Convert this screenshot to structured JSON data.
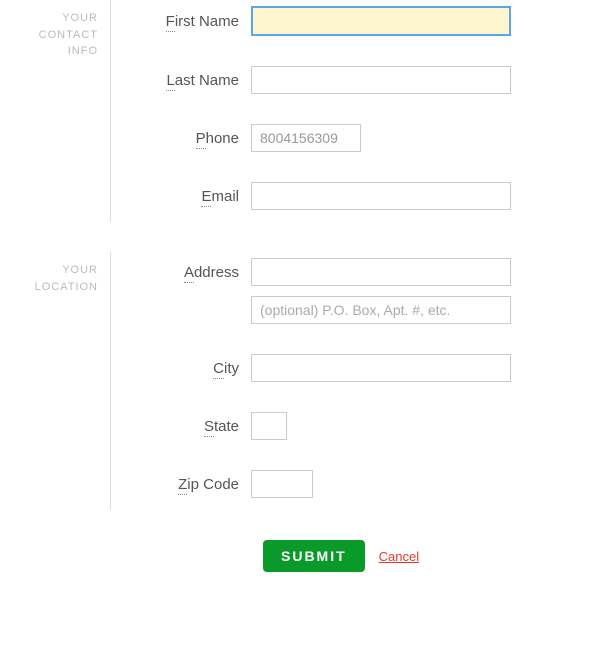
{
  "sections": {
    "contact": {
      "title_line1": "YOUR",
      "title_line2": "CONTACT",
      "title_line3": "INFO",
      "first_name": {
        "label_first": "F",
        "label_rest": "irst Name",
        "value": ""
      },
      "last_name": {
        "label_first": "L",
        "label_rest": "ast Name",
        "value": ""
      },
      "phone": {
        "label_first": "P",
        "label_rest": "hone",
        "value": "8004156309"
      },
      "email": {
        "label_first": "E",
        "label_rest": "mail",
        "value": ""
      }
    },
    "location": {
      "title_line1": "YOUR",
      "title_line2": "LOCATION",
      "address": {
        "label_first": "A",
        "label_rest": "ddress",
        "value": ""
      },
      "address2": {
        "placeholder": "(optional) P.O. Box, Apt. #, etc.",
        "value": ""
      },
      "city": {
        "label_first": "C",
        "label_rest": "ity",
        "value": ""
      },
      "state": {
        "label_first": "S",
        "label_rest": "tate",
        "value": ""
      },
      "zip": {
        "label_first": "Z",
        "label_rest": "ip Code",
        "value": ""
      }
    }
  },
  "actions": {
    "submit": "SUBMIT",
    "cancel": "Cancel"
  }
}
